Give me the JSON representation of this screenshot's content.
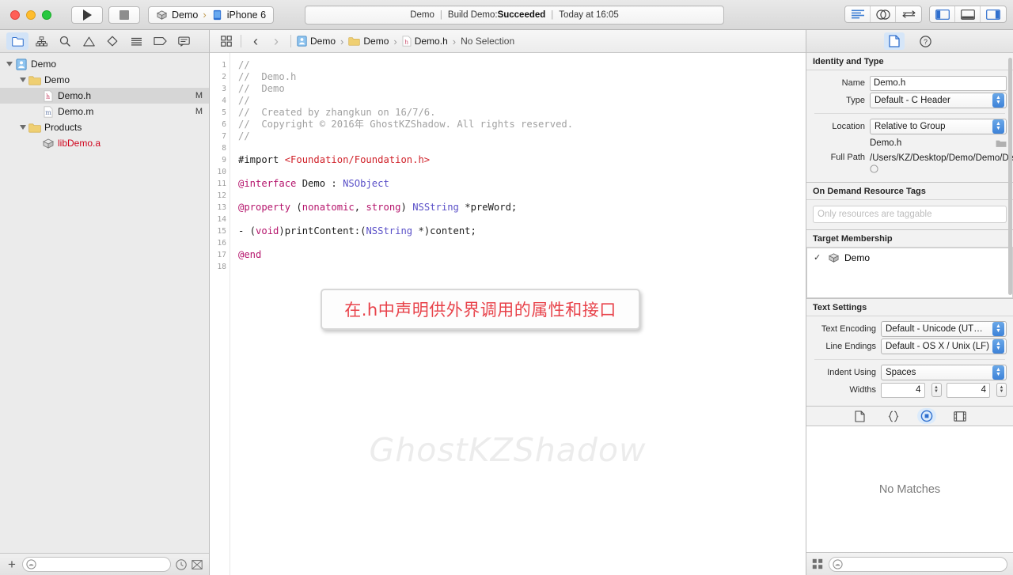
{
  "titlebar": {
    "window_controls": [
      "close-button",
      "minimize-button",
      "zoom-button"
    ],
    "run_label": "Run",
    "stop_label": "Stop",
    "scheme": {
      "project": "Demo",
      "separator": "›",
      "destination": "iPhone 6"
    },
    "status": {
      "project": "Demo",
      "sep1": "|",
      "build_prefix": "Build Demo: ",
      "build_result": "Succeeded",
      "sep2": "|",
      "time": "Today at 16:05"
    },
    "right_buttons": [
      "standard-editor-icon",
      "assistant-editor-icon",
      "version-editor-icon"
    ],
    "panel_toggles": [
      "navigator-toggle-icon",
      "debug-area-toggle-icon",
      "inspector-toggle-icon"
    ]
  },
  "navigator": {
    "tabs": [
      "project-navigator-icon",
      "symbol-navigator-icon",
      "find-navigator-icon",
      "issue-navigator-icon",
      "test-navigator-icon",
      "debug-navigator-icon",
      "breakpoint-navigator-icon",
      "report-navigator-icon"
    ],
    "tree": [
      {
        "label": "Demo",
        "depth": 0,
        "icon": "project-icon",
        "arrow": true,
        "mark": "",
        "selected": false,
        "red": false
      },
      {
        "label": "Demo",
        "depth": 1,
        "icon": "folder-icon",
        "arrow": true,
        "mark": "",
        "selected": false,
        "red": false
      },
      {
        "label": "Demo.h",
        "depth": 2,
        "icon": "header-file-icon",
        "arrow": false,
        "mark": "M",
        "selected": true,
        "red": false
      },
      {
        "label": "Demo.m",
        "depth": 2,
        "icon": "source-file-icon",
        "arrow": false,
        "mark": "M",
        "selected": false,
        "red": false
      },
      {
        "label": "Products",
        "depth": 1,
        "icon": "folder-icon",
        "arrow": true,
        "mark": "",
        "selected": false,
        "red": false
      },
      {
        "label": "libDemo.a",
        "depth": 2,
        "icon": "library-icon",
        "arrow": false,
        "mark": "",
        "selected": false,
        "red": true
      }
    ],
    "bottom": {
      "add_label": "+",
      "filter_placeholder": ""
    }
  },
  "editor": {
    "jumpbar": {
      "related_icon": "related-items-icon",
      "back": "‹",
      "forward": "›",
      "crumbs": [
        {
          "label": "Demo",
          "icon": "project-icon"
        },
        {
          "label": "Demo",
          "icon": "folder-icon"
        },
        {
          "label": "Demo.h",
          "icon": "header-file-icon"
        },
        {
          "label": "No Selection",
          "icon": ""
        }
      ]
    },
    "line_numbers": [
      "1",
      "2",
      "3",
      "4",
      "5",
      "6",
      "7",
      "8",
      "9",
      "10",
      "11",
      "12",
      "13",
      "14",
      "15",
      "16",
      "17",
      "18"
    ],
    "code_lines": [
      [
        {
          "t": "//",
          "c": "cmt"
        }
      ],
      [
        {
          "t": "//  Demo.h",
          "c": "cmt"
        }
      ],
      [
        {
          "t": "//  Demo",
          "c": "cmt"
        }
      ],
      [
        {
          "t": "//",
          "c": "cmt"
        }
      ],
      [
        {
          "t": "//  Created by zhangkun on 16/7/6.",
          "c": "cmt"
        }
      ],
      [
        {
          "t": "//  Copyright © 2016年 GhostKZShadow. All rights reserved.",
          "c": "cmt"
        }
      ],
      [
        {
          "t": "//",
          "c": "cmt"
        }
      ],
      [],
      [
        {
          "t": "#import ",
          "c": "plain"
        },
        {
          "t": "<Foundation/Foundation.h>",
          "c": "pre"
        }
      ],
      [],
      [
        {
          "t": "@interface",
          "c": "kw"
        },
        {
          "t": " ",
          "c": "plain"
        },
        {
          "t": "Demo",
          "c": "plain"
        },
        {
          "t": " : ",
          "c": "plain"
        },
        {
          "t": "NSObject",
          "c": "typ"
        }
      ],
      [],
      [
        {
          "t": "@property",
          "c": "kw"
        },
        {
          "t": " (",
          "c": "plain"
        },
        {
          "t": "nonatomic",
          "c": "kw"
        },
        {
          "t": ", ",
          "c": "plain"
        },
        {
          "t": "strong",
          "c": "kw"
        },
        {
          "t": ") ",
          "c": "plain"
        },
        {
          "t": "NSString",
          "c": "typ"
        },
        {
          "t": " *preWord;",
          "c": "plain"
        }
      ],
      [],
      [
        {
          "t": "- (",
          "c": "plain"
        },
        {
          "t": "void",
          "c": "kw"
        },
        {
          "t": ")printContent:(",
          "c": "plain"
        },
        {
          "t": "NSString",
          "c": "typ"
        },
        {
          "t": " *)content;",
          "c": "plain"
        }
      ],
      [],
      [
        {
          "t": "@end",
          "c": "kw"
        }
      ],
      []
    ],
    "annotation": "在.h中声明供外界调用的属性和接口",
    "watermark": "GhostKZShadow"
  },
  "inspector": {
    "tabs": [
      "file-inspector-icon",
      "quick-help-icon"
    ],
    "identity": {
      "title": "Identity and Type",
      "name_label": "Name",
      "name_value": "Demo.h",
      "type_label": "Type",
      "type_value": "Default - C Header",
      "location_label": "Location",
      "location_value": "Relative to Group",
      "location_file": "Demo.h",
      "fullpath_label": "Full Path",
      "fullpath_value": "/Users/KZ/Desktop/Demo/Demo/Demo.h"
    },
    "ondemand": {
      "title": "On Demand Resource Tags",
      "placeholder": "Only resources are taggable"
    },
    "target_membership": {
      "title": "Target Membership",
      "items": [
        {
          "label": "Demo",
          "checked": true
        }
      ]
    },
    "text_settings": {
      "title": "Text Settings",
      "encoding_label": "Text Encoding",
      "encoding_value": "Default - Unicode (UT…",
      "endings_label": "Line Endings",
      "endings_value": "Default - OS X / Unix (LF)",
      "indent_label": "Indent Using",
      "indent_value": "Spaces",
      "widths_label": "Widths",
      "widths_tab": "4",
      "widths_indent": "4"
    },
    "library_tabs": [
      "file-template-library-icon",
      "code-snippet-library-icon",
      "object-library-icon",
      "media-library-icon"
    ],
    "library": {
      "empty_message": "No Matches",
      "filter_placeholder": ""
    }
  }
}
